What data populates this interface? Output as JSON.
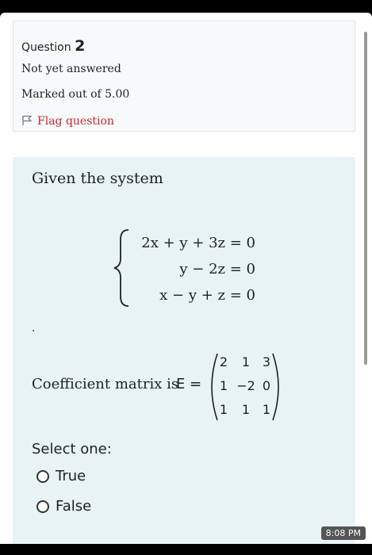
{
  "question": {
    "label": "Question",
    "number": "2",
    "status": "Not yet answered",
    "marks": "Marked out of 5.00",
    "flag_label": "Flag question"
  },
  "prompt": {
    "intro": "Given the system",
    "equations": [
      "2x + y + 3z = 0",
      "y − 2z = 0",
      "x − y + z = 0"
    ],
    "dot": ".",
    "coef_label": "Coefficient matrix is",
    "coef_symbol": "E =",
    "matrix": [
      [
        "2",
        "1",
        "3"
      ],
      [
        "1",
        "−2",
        "0"
      ],
      [
        "1",
        "1",
        "1"
      ]
    ]
  },
  "answer": {
    "select_label": "Select one:",
    "options": [
      "True",
      "False"
    ]
  },
  "status_bar": {
    "time": "8:08 PM"
  }
}
